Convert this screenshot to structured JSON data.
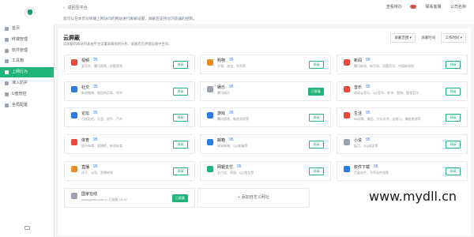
{
  "sidebar": {
    "items": [
      {
        "label": "首页",
        "active": false,
        "icon": "home-icon"
      },
      {
        "label": "终端管理",
        "active": false,
        "icon": "terminal-icon"
      },
      {
        "label": "软件管理",
        "active": false,
        "icon": "software-icon"
      },
      {
        "label": "工具箱",
        "active": false,
        "icon": "toolbox-icon"
      },
      {
        "label": "上网行为",
        "active": true,
        "icon": "internet-behavior-icon"
      },
      {
        "label": "准入防护",
        "active": false,
        "icon": "access-protection-icon"
      },
      {
        "label": "U盘管控",
        "active": false,
        "icon": "usb-icon"
      },
      {
        "label": "全局配置",
        "active": false,
        "icon": "settings-icon"
      }
    ]
  },
  "topbar": {
    "back": "返回至平台",
    "alert": "查看待办",
    "alert_badge": "99",
    "contact": "联系客服",
    "company": "公司名称"
  },
  "notice": "您可以在本页对终端上网访问的网站进行屏蔽设置，屏蔽后支持对浏览器的控制。",
  "panel": {
    "title": "云屏蔽",
    "subtitle": "云屏蔽的网站列表由平台设置屏蔽规则分析，屏蔽后在终端设备中生效。",
    "filter_range": "屏蔽范围 ▾",
    "filter_time_label": "屏蔽时间",
    "filter_time": "工作时间 ▾"
  },
  "cards": [
    {
      "name": "视频",
      "score": "95",
      "desc": "爱奇艺、腾讯视频、优酷视频",
      "btn": "屏蔽",
      "filled": false,
      "color": "#e84a3c"
    },
    {
      "name": "购物",
      "score": "95",
      "desc": "天猫、淘宝、京东等",
      "btn": "屏蔽",
      "filled": false,
      "color": "#f08a24"
    },
    {
      "name": "新闻",
      "score": "95",
      "desc": "腾讯新闻、新华网、凤凰资讯、中国新闻网",
      "btn": "屏蔽",
      "filled": false,
      "color": "#e84a3c"
    },
    {
      "name": "社交",
      "score": "95",
      "desc": "新浪微博、微信网页版、知乎",
      "btn": "屏蔽",
      "filled": false,
      "color": "#2b7be4"
    },
    {
      "name": "娱乐",
      "score": "95",
      "desc": "腾讯娱乐",
      "btn": "已屏蔽",
      "filled": true,
      "color": "#9aa3ad"
    },
    {
      "name": "音乐",
      "score": "95",
      "desc": "网易云音乐、QQ音乐、虾米、酷狗、酷我音乐",
      "btn": "屏蔽",
      "filled": false,
      "color": "#e84a3c"
    },
    {
      "name": "论坛",
      "score": "95",
      "desc": "百度贴吧、天涯、虎扑、汽车",
      "btn": "屏蔽",
      "filled": false,
      "color": "#2b7be4"
    },
    {
      "name": "游戏",
      "score": "95",
      "desc": "腾讯游戏、新浪游戏等",
      "btn": "屏蔽",
      "filled": false,
      "color": "#2b7be4"
    },
    {
      "name": "生活",
      "score": "95",
      "desc": "58同城、美团、大众点评、去哪儿、携程旅游等",
      "btn": "屏蔽",
      "filled": false,
      "color": "#e84a3c"
    },
    {
      "name": "体育",
      "score": "95",
      "desc": "虎扑体育、直播吧、新浪体育",
      "btn": "屏蔽",
      "filled": false,
      "color": "#e84a3c"
    },
    {
      "name": "邮箱",
      "score": "95",
      "desc": "网易邮箱、QQ邮箱等",
      "btn": "屏蔽",
      "filled": false,
      "color": "#2b7be4"
    },
    {
      "name": "小说",
      "score": "95",
      "desc": "起点、QQ阅读等",
      "btn": "屏蔽",
      "filled": false,
      "color": "#9aa3ad"
    },
    {
      "name": "直播",
      "score": "95",
      "desc": "虎牙、斗鱼、直播吧等",
      "btn": "屏蔽",
      "filled": false,
      "color": "#f08a24"
    },
    {
      "name": "网银支付",
      "score": "95",
      "desc": "支付宝、网银、QQ钱包等",
      "btn": "屏蔽",
      "filled": false,
      "color": "#1fb57a"
    },
    {
      "name": "软件下载",
      "score": "95",
      "desc": "百度软件、华军软件园等",
      "btn": "屏蔽",
      "filled": false,
      "color": "#2b7be4"
    },
    {
      "name": "国家在线",
      "score": "",
      "desc": "www.gome.com.cn   已屏蔽 15:20",
      "btn": "已屏蔽",
      "filled": true,
      "color": "#9aa3ad"
    }
  ],
  "add_card": "+ 添加自定义网址",
  "watermark": "www.mydll.cn"
}
